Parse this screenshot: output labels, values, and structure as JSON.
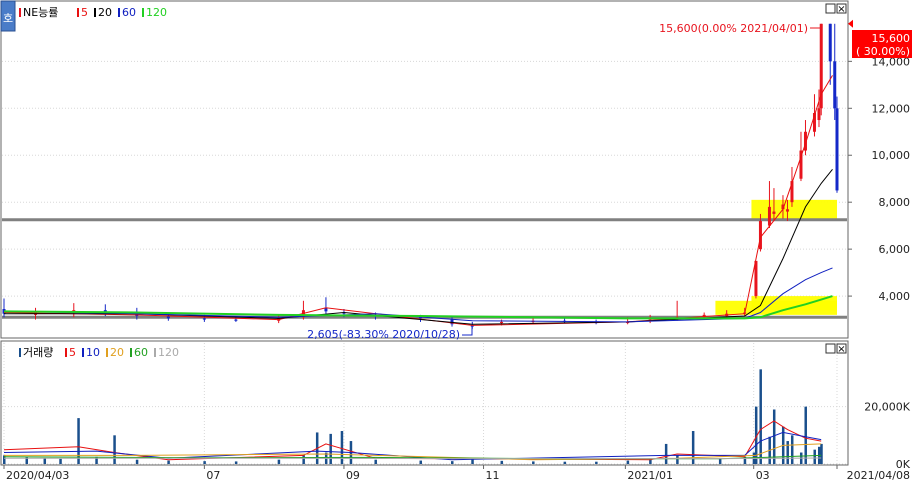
{
  "corner_button": "호",
  "window_buttons": {
    "minimize": "□",
    "close": "×"
  },
  "colors": {
    "up": "#e8141e",
    "down": "#1428c8",
    "ma5": "#e81010",
    "ma20": "#000000",
    "ma60": "#1020c0",
    "ma120": "#22d022",
    "vol_bar": "#1a4f8c",
    "vma5": "#e81010",
    "vma10": "#1020c0",
    "vma20": "#e0a020",
    "vma60": "#22a022",
    "vma120": "#aaaaaa",
    "highlight": "#ffff00",
    "level_line": "#808080",
    "current_price_bg": "#ff0000",
    "axis_text": "#222222",
    "grid": "#d8d8d8"
  },
  "chart_data": [
    {
      "type": "candlestick",
      "legend": [
        {
          "label": "NE능률",
          "color": "#e8141e"
        },
        {
          "label": "5",
          "color": "#e81010"
        },
        {
          "label": "20",
          "color": "#000000"
        },
        {
          "label": "60",
          "color": "#1020c0"
        },
        {
          "label": "120",
          "color": "#22d022"
        }
      ],
      "ylim": [
        2300,
        16400
      ],
      "yticks": [
        4000,
        6000,
        8000,
        10000,
        12000,
        14000
      ],
      "ytick_labels": [
        "4,000",
        "6,000",
        "8,000",
        "10,000",
        "12,000",
        "14,000"
      ],
      "annotations": [
        {
          "text": "15,600(0.00% 2021/04/01)",
          "color": "#e8141e"
        },
        {
          "text": "2,605(-83.30% 2020/10/28)",
          "color": "#1428c8"
        }
      ],
      "current_price": {
        "value": "15,600",
        "change": "( 30.00%)"
      },
      "horizontal_levels": [
        7250,
        3100
      ],
      "highlight_zones": [
        {
          "x_start": "2021/02/13",
          "x_end": "2021/04/08",
          "y_low": 3200,
          "y_high": 3800
        },
        {
          "x_start": "2021/03/01",
          "x_end": "2021/04/08",
          "y_low": 3400,
          "y_high": 4000
        },
        {
          "x_start": "2021/03/01",
          "x_end": "2021/04/08",
          "y_low": 7300,
          "y_high": 8100
        }
      ],
      "series": [
        {
          "kind": "ohlc",
          "dates": [
            "2020/04/03",
            "2020/04/17",
            "2020/05/04",
            "2020/05/18",
            "2020/06/01",
            "2020/06/15",
            "2020/07/01",
            "2020/07/15",
            "2020/08/03",
            "2020/08/14",
            "2020/08/24",
            "2020/09/01",
            "2020/09/15",
            "2020/10/05",
            "2020/10/19",
            "2020/10/28",
            "2020/11/10",
            "2020/11/24",
            "2020/12/08",
            "2020/12/22",
            "2021/01/05",
            "2021/01/15",
            "2021/01/27",
            "2021/02/08",
            "2021/02/18",
            "2021/02/26",
            "2021/03/03",
            "2021/03/05",
            "2021/03/09",
            "2021/03/11",
            "2021/03/15",
            "2021/03/17",
            "2021/03/19",
            "2021/03/23",
            "2021/03/25",
            "2021/03/29",
            "2021/03/31",
            "2021/04/01",
            "2021/04/05",
            "2021/04/07",
            "2021/04/08"
          ],
          "open": [
            3450,
            3200,
            3300,
            3400,
            3250,
            3150,
            3050,
            3000,
            2950,
            3100,
            3500,
            3300,
            3200,
            3100,
            3000,
            2750,
            2850,
            2900,
            2950,
            2900,
            2850,
            2950,
            3000,
            3100,
            3150,
            3250,
            4000,
            6000,
            7000,
            7500,
            7700,
            7600,
            8000,
            9000,
            10200,
            11000,
            11500,
            12000,
            15600,
            14000,
            12000
          ],
          "high": [
            3900,
            3500,
            3700,
            3650,
            3500,
            3300,
            3200,
            3150,
            3200,
            3800,
            3950,
            3450,
            3300,
            3200,
            3100,
            2900,
            3000,
            3050,
            3100,
            3000,
            3100,
            3200,
            3800,
            3300,
            3400,
            3500,
            5000,
            7500,
            8900,
            8600,
            8300,
            8100,
            9500,
            11000,
            11500,
            12600,
            12800,
            15600,
            15600,
            15600,
            12500
          ],
          "low": [
            3100,
            3000,
            3100,
            3150,
            3000,
            2950,
            2900,
            2900,
            2850,
            3000,
            3250,
            3100,
            3000,
            2900,
            2700,
            2605,
            2750,
            2800,
            2850,
            2800,
            2800,
            2850,
            2950,
            3000,
            3050,
            3150,
            3900,
            5900,
            6900,
            7200,
            7300,
            7200,
            7800,
            8900,
            10000,
            10800,
            11200,
            11700,
            13000,
            11500,
            8400
          ],
          "close": [
            3250,
            3300,
            3400,
            3300,
            3150,
            3050,
            3000,
            2950,
            3050,
            3400,
            3350,
            3250,
            3150,
            3050,
            2800,
            2700,
            2900,
            2950,
            2900,
            2850,
            2900,
            3000,
            3100,
            3200,
            3250,
            3300,
            5500,
            7200,
            7800,
            7600,
            7900,
            7700,
            8900,
            10200,
            11000,
            11800,
            12000,
            15600,
            14000,
            12000,
            8500
          ]
        },
        {
          "name": "5",
          "kind": "ma",
          "color": "#e81010",
          "dates": [
            "2020/04/03",
            "2020/06/01",
            "2020/08/03",
            "2020/08/24",
            "2020/10/28",
            "2021/01/05",
            "2021/02/26",
            "2021/03/05",
            "2021/03/15",
            "2021/03/25",
            "2021/04/01",
            "2021/04/06"
          ],
          "values": [
            3300,
            3200,
            3000,
            3500,
            2750,
            2900,
            3250,
            6500,
            7700,
            10500,
            12600,
            13400
          ]
        },
        {
          "name": "20",
          "kind": "ma",
          "color": "#000000",
          "dates": [
            "2020/04/03",
            "2020/06/01",
            "2020/08/03",
            "2020/09/01",
            "2020/10/28",
            "2021/01/05",
            "2021/02/26",
            "2021/03/05",
            "2021/03/15",
            "2021/03/25",
            "2021/04/01",
            "2021/04/06"
          ],
          "values": [
            3250,
            3250,
            3050,
            3300,
            2800,
            2900,
            3150,
            3600,
            5600,
            7800,
            8800,
            9400
          ]
        },
        {
          "name": "60",
          "kind": "ma",
          "color": "#1020c0",
          "dates": [
            "2020/04/03",
            "2020/06/01",
            "2020/08/03",
            "2020/09/15",
            "2020/10/28",
            "2021/01/05",
            "2021/02/26",
            "2021/03/05",
            "2021/03/15",
            "2021/03/25",
            "2021/04/01",
            "2021/04/06"
          ],
          "values": [
            3350,
            3250,
            3100,
            3250,
            2950,
            2900,
            3050,
            3300,
            4100,
            4700,
            5000,
            5200
          ]
        },
        {
          "name": "120",
          "kind": "ma",
          "color": "#22d022",
          "dates": [
            "2020/04/03",
            "2020/06/01",
            "2020/08/03",
            "2020/10/05",
            "2021/01/05",
            "2021/02/26",
            "2021/03/05",
            "2021/03/15",
            "2021/03/25",
            "2021/04/01",
            "2021/04/06"
          ],
          "values": [
            3350,
            3300,
            3200,
            3150,
            3050,
            3050,
            3100,
            3400,
            3650,
            3850,
            4000
          ]
        }
      ]
    },
    {
      "type": "bar",
      "legend": [
        {
          "label": "거래량",
          "color": "#1a4f8c"
        },
        {
          "label": "5",
          "color": "#e81010"
        },
        {
          "label": "10",
          "color": "#1020c0"
        },
        {
          "label": "20",
          "color": "#e0a020"
        },
        {
          "label": "60",
          "color": "#22a022"
        },
        {
          "label": "120",
          "color": "#aaaaaa"
        }
      ],
      "unit": "K",
      "ylim": [
        0,
        38000
      ],
      "yticks": [
        0,
        20000
      ],
      "ytick_labels": [
        "0K",
        "20,000K"
      ],
      "x": [
        "2020/04/03",
        "2020/04/13",
        "2020/04/21",
        "2020/04/28",
        "2020/05/06",
        "2020/05/14",
        "2020/05/22",
        "2020/06/01",
        "2020/06/15",
        "2020/07/01",
        "2020/07/15",
        "2020/08/03",
        "2020/08/14",
        "2020/08/20",
        "2020/08/24",
        "2020/08/26",
        "2020/08/31",
        "2020/09/04",
        "2020/09/15",
        "2020/10/05",
        "2020/10/19",
        "2020/10/28",
        "2020/11/10",
        "2020/11/24",
        "2020/12/08",
        "2020/12/22",
        "2021/01/05",
        "2021/01/15",
        "2021/01/22",
        "2021/01/27",
        "2021/02/03",
        "2021/02/15",
        "2021/02/26",
        "2021/03/02",
        "2021/03/03",
        "2021/03/05",
        "2021/03/09",
        "2021/03/11",
        "2021/03/15",
        "2021/03/17",
        "2021/03/19",
        "2021/03/23",
        "2021/03/25",
        "2021/03/29",
        "2021/03/31",
        "2021/04/01"
      ],
      "values": [
        3000,
        2500,
        2000,
        1800,
        16000,
        2500,
        10000,
        1500,
        1200,
        1000,
        900,
        1500,
        3000,
        11000,
        4000,
        10500,
        11500,
        8000,
        1500,
        1200,
        1000,
        1800,
        1100,
        900,
        800,
        800,
        1200,
        2000,
        7000,
        3000,
        11500,
        2000,
        2500,
        4000,
        20000,
        33000,
        9500,
        19000,
        13000,
        8000,
        10000,
        4000,
        20000,
        5000,
        6000,
        7000
      ],
      "series": [
        {
          "name": "5",
          "color": "#e81010",
          "x": [
            "2020/04/03",
            "2020/05/06",
            "2020/05/22",
            "2020/06/15",
            "2020/08/14",
            "2020/08/24",
            "2020/09/15",
            "2021/01/15",
            "2021/01/27",
            "2021/02/26",
            "2021/03/05",
            "2021/03/11",
            "2021/03/17",
            "2021/03/25",
            "2021/04/01"
          ],
          "values": [
            5000,
            6000,
            4000,
            1500,
            3000,
            7000,
            2000,
            1500,
            3500,
            2500,
            12000,
            15000,
            12000,
            9000,
            8000
          ]
        },
        {
          "name": "10",
          "color": "#1020c0",
          "x": [
            "2020/04/03",
            "2020/05/14",
            "2020/06/15",
            "2020/08/20",
            "2020/09/04",
            "2020/10/19",
            "2021/01/22",
            "2021/02/26",
            "2021/03/05",
            "2021/03/15",
            "2021/03/25",
            "2021/04/01"
          ],
          "values": [
            4000,
            4500,
            2000,
            4500,
            4000,
            1500,
            3000,
            3000,
            8000,
            11000,
            9500,
            8500
          ]
        },
        {
          "name": "20",
          "color": "#e0a020",
          "x": [
            "2020/04/03",
            "2020/06/01",
            "2020/08/24",
            "2020/09/15",
            "2020/11/24",
            "2021/01/27",
            "2021/03/03",
            "2021/03/15",
            "2021/04/01"
          ],
          "values": [
            3000,
            3000,
            3500,
            3000,
            1500,
            2000,
            3000,
            6500,
            7000
          ]
        },
        {
          "name": "60",
          "color": "#22a022",
          "x": [
            "2020/04/03",
            "2020/07/01",
            "2020/09/15",
            "2020/12/08",
            "2021/02/15",
            "2021/03/15",
            "2021/04/01"
          ],
          "values": [
            2500,
            2200,
            2300,
            1800,
            1800,
            2500,
            3000
          ]
        },
        {
          "name": "120",
          "color": "#aaaaaa",
          "x": [
            "2020/04/03",
            "2020/08/03",
            "2020/11/10",
            "2021/02/15",
            "2021/04/01"
          ],
          "values": [
            2000,
            2000,
            1900,
            1900,
            2100
          ]
        }
      ]
    }
  ],
  "x_axis": {
    "domain": [
      "2020/04/03",
      "2021/04/12"
    ],
    "ticks": [
      {
        "date": "2020/04/03",
        "label": "2020/04/03"
      },
      {
        "date": "2020/07/01",
        "label": "07"
      },
      {
        "date": "2020/09/01",
        "label": "09"
      },
      {
        "date": "2020/11/02",
        "label": "11"
      },
      {
        "date": "2021/01/04",
        "label": "2021/01"
      },
      {
        "date": "2021/03/02",
        "label": "03"
      },
      {
        "date": "2021/04/08",
        "label": "2021/04/08"
      }
    ]
  }
}
